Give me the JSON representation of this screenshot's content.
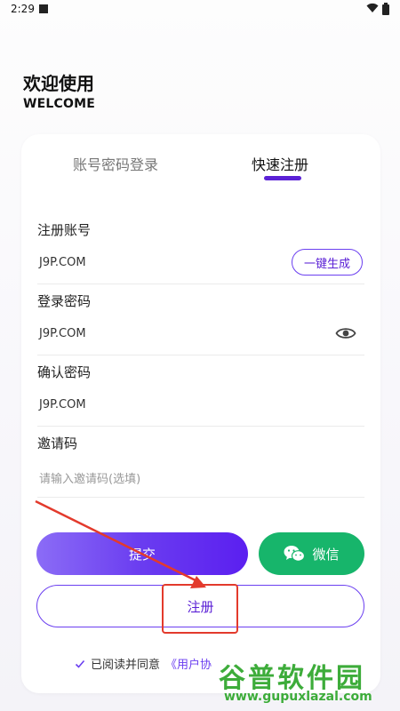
{
  "status_bar": {
    "time": "2:29"
  },
  "welcome": {
    "title": "欢迎使用",
    "subtitle": "WELCOME"
  },
  "tabs": [
    {
      "label": "账号密码登录",
      "active": false
    },
    {
      "label": "快速注册",
      "active": true
    }
  ],
  "fields": {
    "account": {
      "label": "注册账号",
      "value": "J9P.COM",
      "action": "一键生成"
    },
    "password": {
      "label": "登录密码",
      "value": "J9P.COM"
    },
    "confirm": {
      "label": "确认密码",
      "value": "J9P.COM"
    },
    "invite": {
      "label": "邀请码",
      "placeholder": "请输入邀请码(选填)"
    }
  },
  "buttons": {
    "submit": "提交",
    "wechat": "微信",
    "register": "注册"
  },
  "agreement": {
    "text": "已阅读并同意",
    "link": "《用户协"
  },
  "watermark": {
    "main": "谷普软件园",
    "sub": "www.gupuxlazal.com"
  },
  "colors": {
    "accent": "#5b21d6",
    "wechat_green": "#17b56b",
    "annotation_red": "#e33a2c"
  },
  "icons": [
    "wifi-icon",
    "battery-icon",
    "eye-icon",
    "wechat-icon",
    "check-icon",
    "annotation-arrow"
  ]
}
